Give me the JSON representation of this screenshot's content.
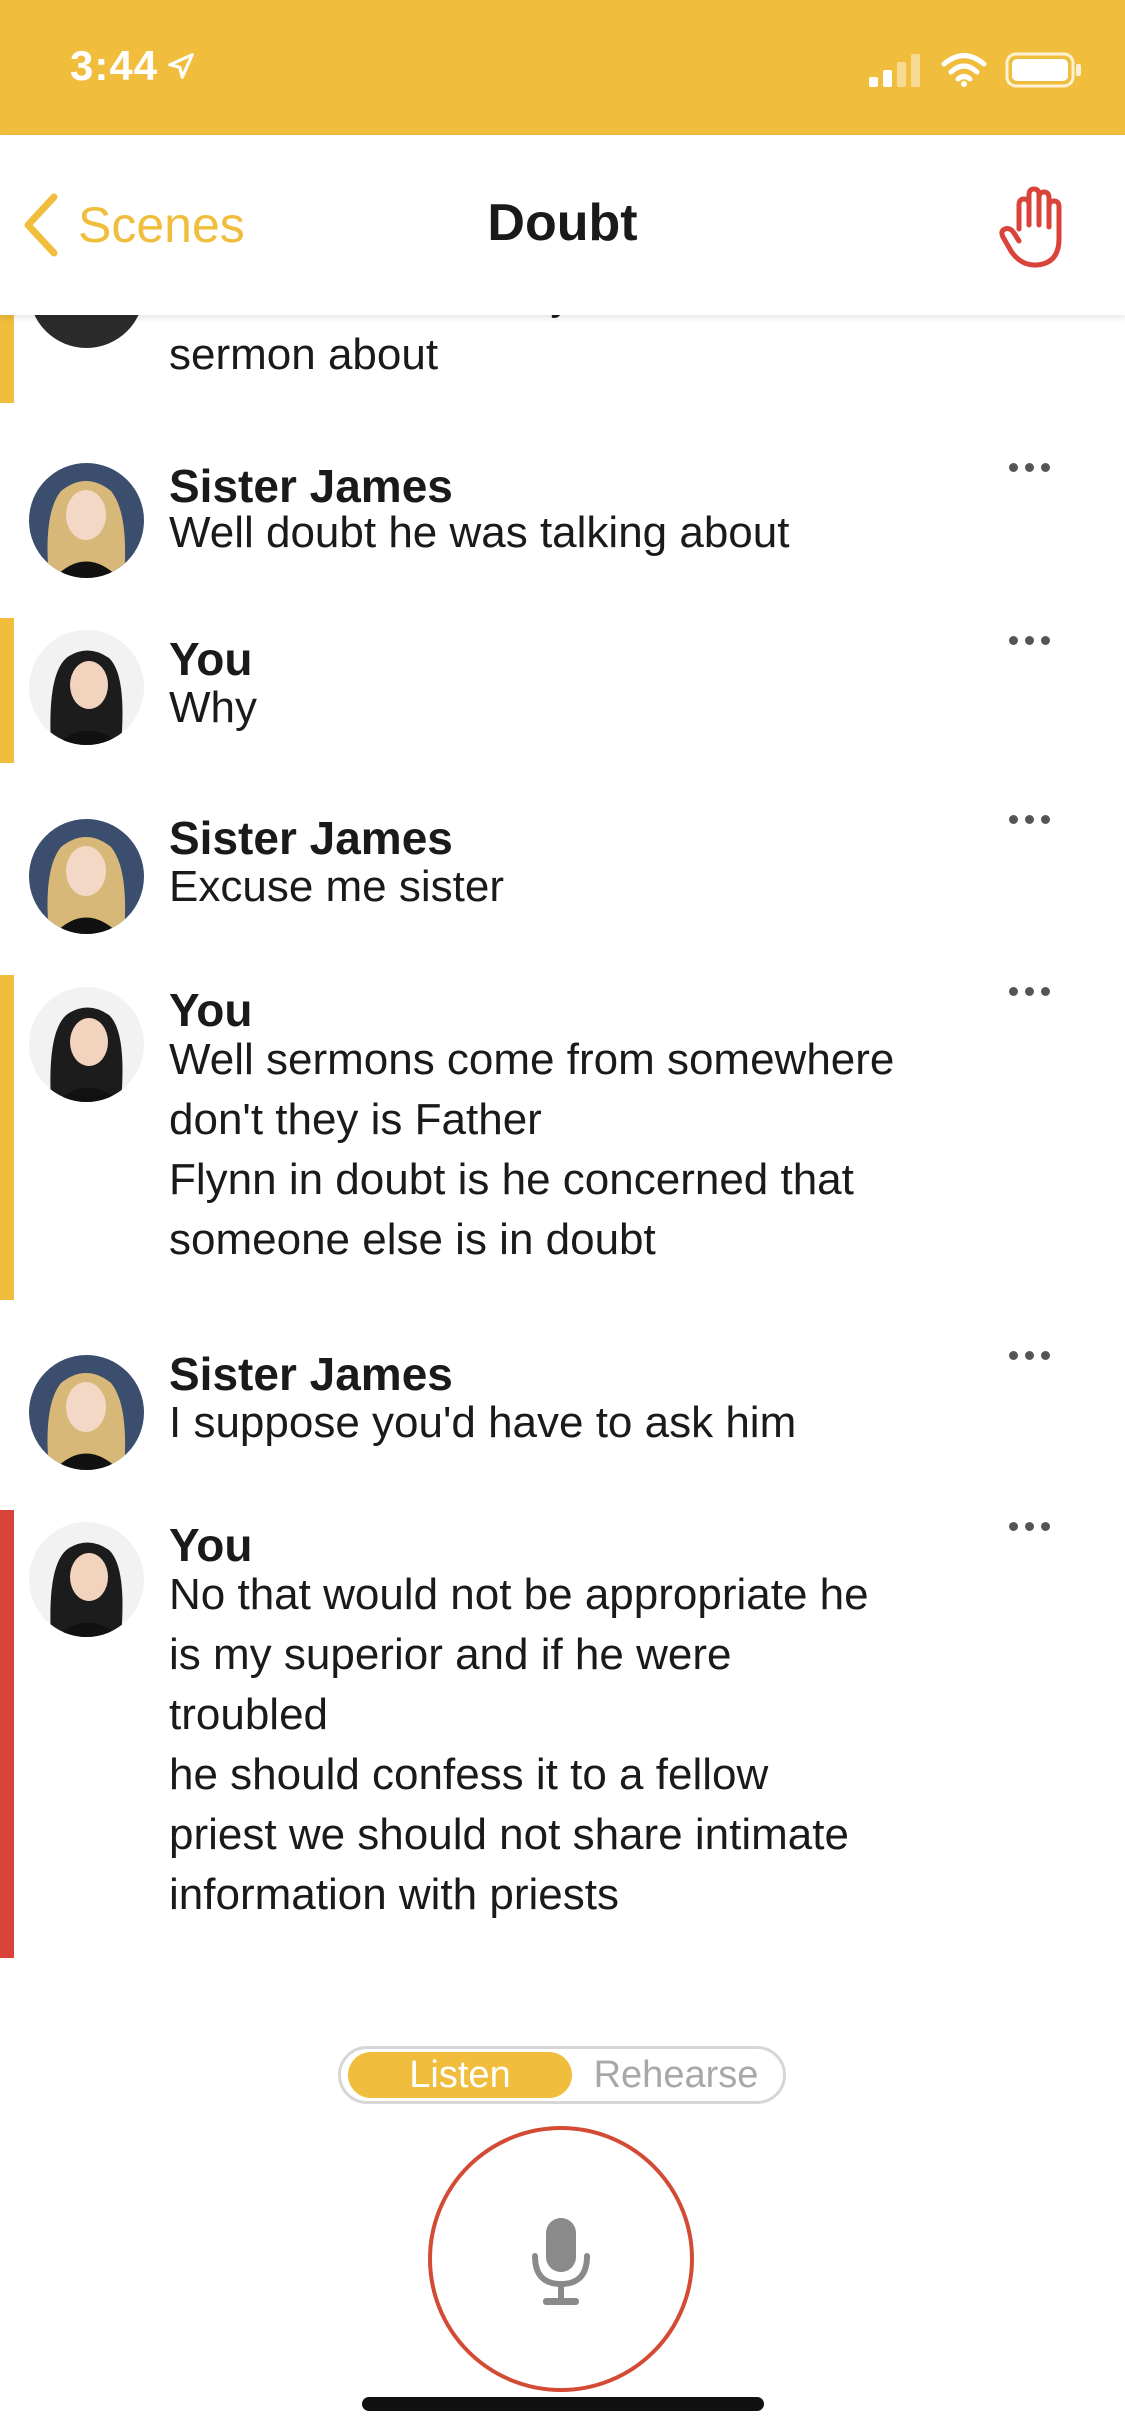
{
  "status_bar": {
    "time": "3:44"
  },
  "nav": {
    "back_label": "Scenes",
    "title": "Doubt"
  },
  "messages": [
    {
      "speaker": "",
      "text": "What was Father Flynn's\nsermon about",
      "accent": "#f0bd3d"
    },
    {
      "speaker": "Sister James",
      "text": "Well doubt he was talking about",
      "accent": ""
    },
    {
      "speaker": "You",
      "text": "Why",
      "accent": "#f0bd3d"
    },
    {
      "speaker": "Sister James",
      "text": "Excuse me sister",
      "accent": ""
    },
    {
      "speaker": "You",
      "text": "Well sermons come from somewhere\ndon't they is Father\nFlynn in doubt is he concerned that\nsomeone else is in doubt",
      "accent": "#f0bd3d"
    },
    {
      "speaker": "Sister James",
      "text": "I suppose you'd have to ask him",
      "accent": ""
    },
    {
      "speaker": "You",
      "text": "No that would not be appropriate he\nis my superior and if he were\ntroubled\n he should confess it to a fellow\npriest we should not share intimate\ninformation with priests",
      "accent": "#d9433a"
    }
  ],
  "mode_toggle": {
    "listen_label": "Listen",
    "rehearse_label": "Rehearse",
    "selected": "Listen"
  },
  "colors": {
    "brand": "#f0bd3d",
    "error": "#d9433a",
    "mic_ring": "#d34a35"
  },
  "icons": {
    "back": "chevron-left-icon",
    "hand": "raised-hand-icon",
    "mic": "microphone-icon",
    "more": "more-horizontal-icon"
  }
}
